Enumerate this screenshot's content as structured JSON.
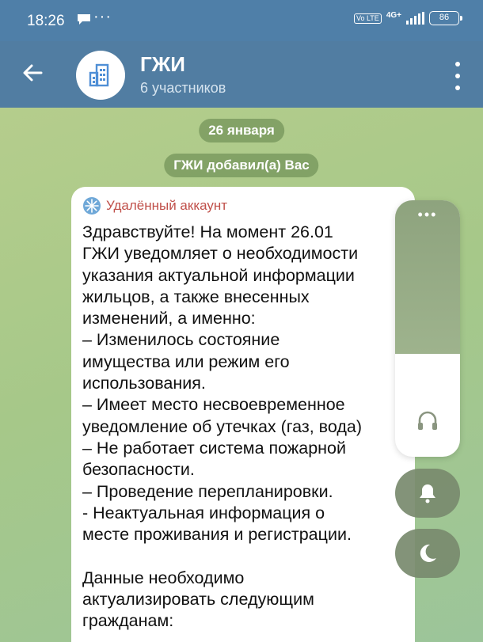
{
  "status_bar": {
    "time": "18:26",
    "dots": "···",
    "network": "4G+",
    "volte": "Vo LTE",
    "battery": "86"
  },
  "header": {
    "title": "ГЖИ",
    "subtitle": "6 участников",
    "icons": [
      "back-arrow-icon",
      "building-icon",
      "more-vertical-icon"
    ]
  },
  "chat": {
    "date_label": "26 января",
    "service_message": "ГЖИ добавил(а) Вас",
    "message": {
      "sender": "Удалённый аккаунт",
      "text": "Здравствуйте! На момент 26.01\nГЖИ уведомляет о необходимости\nуказания актуальной информации\nжильцов, а также внесенных\nизменений, а именно:\n– Изменилось состояние\nимущества или режим его\nиспользования.\n– Имеет место несвоевременное\nуведомление об утечках (газ, вода)\n– Не работает система пожарной\nбезопасности.\n– Проведение перепланировки.\n- Неактуальная информация о\nместе проживания и регистрации.\n\nДанные необходимо\nактуализировать следующим\nгражданам:"
    }
  },
  "volume_panel": {
    "level": 0.6,
    "icons": [
      "more-horizontal-icon",
      "headphones-icon",
      "bell-icon",
      "moon-icon"
    ]
  },
  "colors": {
    "header": "#517da2",
    "sender": "#c0504a",
    "bubble": "#ffffff"
  }
}
